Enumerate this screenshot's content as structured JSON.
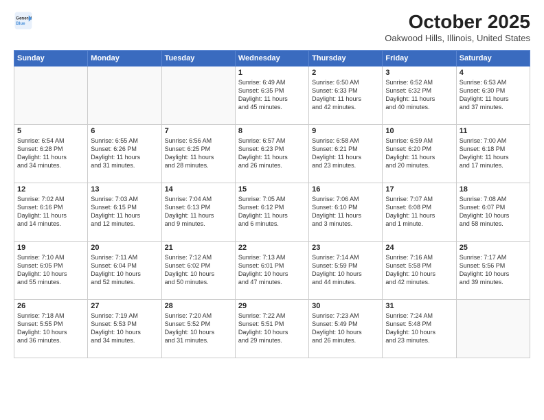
{
  "header": {
    "logo_general": "General",
    "logo_blue": "Blue",
    "month": "October 2025",
    "location": "Oakwood Hills, Illinois, United States"
  },
  "weekdays": [
    "Sunday",
    "Monday",
    "Tuesday",
    "Wednesday",
    "Thursday",
    "Friday",
    "Saturday"
  ],
  "weeks": [
    [
      {
        "day": "",
        "info": ""
      },
      {
        "day": "",
        "info": ""
      },
      {
        "day": "",
        "info": ""
      },
      {
        "day": "1",
        "info": "Sunrise: 6:49 AM\nSunset: 6:35 PM\nDaylight: 11 hours\nand 45 minutes."
      },
      {
        "day": "2",
        "info": "Sunrise: 6:50 AM\nSunset: 6:33 PM\nDaylight: 11 hours\nand 42 minutes."
      },
      {
        "day": "3",
        "info": "Sunrise: 6:52 AM\nSunset: 6:32 PM\nDaylight: 11 hours\nand 40 minutes."
      },
      {
        "day": "4",
        "info": "Sunrise: 6:53 AM\nSunset: 6:30 PM\nDaylight: 11 hours\nand 37 minutes."
      }
    ],
    [
      {
        "day": "5",
        "info": "Sunrise: 6:54 AM\nSunset: 6:28 PM\nDaylight: 11 hours\nand 34 minutes."
      },
      {
        "day": "6",
        "info": "Sunrise: 6:55 AM\nSunset: 6:26 PM\nDaylight: 11 hours\nand 31 minutes."
      },
      {
        "day": "7",
        "info": "Sunrise: 6:56 AM\nSunset: 6:25 PM\nDaylight: 11 hours\nand 28 minutes."
      },
      {
        "day": "8",
        "info": "Sunrise: 6:57 AM\nSunset: 6:23 PM\nDaylight: 11 hours\nand 26 minutes."
      },
      {
        "day": "9",
        "info": "Sunrise: 6:58 AM\nSunset: 6:21 PM\nDaylight: 11 hours\nand 23 minutes."
      },
      {
        "day": "10",
        "info": "Sunrise: 6:59 AM\nSunset: 6:20 PM\nDaylight: 11 hours\nand 20 minutes."
      },
      {
        "day": "11",
        "info": "Sunrise: 7:00 AM\nSunset: 6:18 PM\nDaylight: 11 hours\nand 17 minutes."
      }
    ],
    [
      {
        "day": "12",
        "info": "Sunrise: 7:02 AM\nSunset: 6:16 PM\nDaylight: 11 hours\nand 14 minutes."
      },
      {
        "day": "13",
        "info": "Sunrise: 7:03 AM\nSunset: 6:15 PM\nDaylight: 11 hours\nand 12 minutes."
      },
      {
        "day": "14",
        "info": "Sunrise: 7:04 AM\nSunset: 6:13 PM\nDaylight: 11 hours\nand 9 minutes."
      },
      {
        "day": "15",
        "info": "Sunrise: 7:05 AM\nSunset: 6:12 PM\nDaylight: 11 hours\nand 6 minutes."
      },
      {
        "day": "16",
        "info": "Sunrise: 7:06 AM\nSunset: 6:10 PM\nDaylight: 11 hours\nand 3 minutes."
      },
      {
        "day": "17",
        "info": "Sunrise: 7:07 AM\nSunset: 6:08 PM\nDaylight: 11 hours\nand 1 minute."
      },
      {
        "day": "18",
        "info": "Sunrise: 7:08 AM\nSunset: 6:07 PM\nDaylight: 10 hours\nand 58 minutes."
      }
    ],
    [
      {
        "day": "19",
        "info": "Sunrise: 7:10 AM\nSunset: 6:05 PM\nDaylight: 10 hours\nand 55 minutes."
      },
      {
        "day": "20",
        "info": "Sunrise: 7:11 AM\nSunset: 6:04 PM\nDaylight: 10 hours\nand 52 minutes."
      },
      {
        "day": "21",
        "info": "Sunrise: 7:12 AM\nSunset: 6:02 PM\nDaylight: 10 hours\nand 50 minutes."
      },
      {
        "day": "22",
        "info": "Sunrise: 7:13 AM\nSunset: 6:01 PM\nDaylight: 10 hours\nand 47 minutes."
      },
      {
        "day": "23",
        "info": "Sunrise: 7:14 AM\nSunset: 5:59 PM\nDaylight: 10 hours\nand 44 minutes."
      },
      {
        "day": "24",
        "info": "Sunrise: 7:16 AM\nSunset: 5:58 PM\nDaylight: 10 hours\nand 42 minutes."
      },
      {
        "day": "25",
        "info": "Sunrise: 7:17 AM\nSunset: 5:56 PM\nDaylight: 10 hours\nand 39 minutes."
      }
    ],
    [
      {
        "day": "26",
        "info": "Sunrise: 7:18 AM\nSunset: 5:55 PM\nDaylight: 10 hours\nand 36 minutes."
      },
      {
        "day": "27",
        "info": "Sunrise: 7:19 AM\nSunset: 5:53 PM\nDaylight: 10 hours\nand 34 minutes."
      },
      {
        "day": "28",
        "info": "Sunrise: 7:20 AM\nSunset: 5:52 PM\nDaylight: 10 hours\nand 31 minutes."
      },
      {
        "day": "29",
        "info": "Sunrise: 7:22 AM\nSunset: 5:51 PM\nDaylight: 10 hours\nand 29 minutes."
      },
      {
        "day": "30",
        "info": "Sunrise: 7:23 AM\nSunset: 5:49 PM\nDaylight: 10 hours\nand 26 minutes."
      },
      {
        "day": "31",
        "info": "Sunrise: 7:24 AM\nSunset: 5:48 PM\nDaylight: 10 hours\nand 23 minutes."
      },
      {
        "day": "",
        "info": ""
      }
    ]
  ]
}
